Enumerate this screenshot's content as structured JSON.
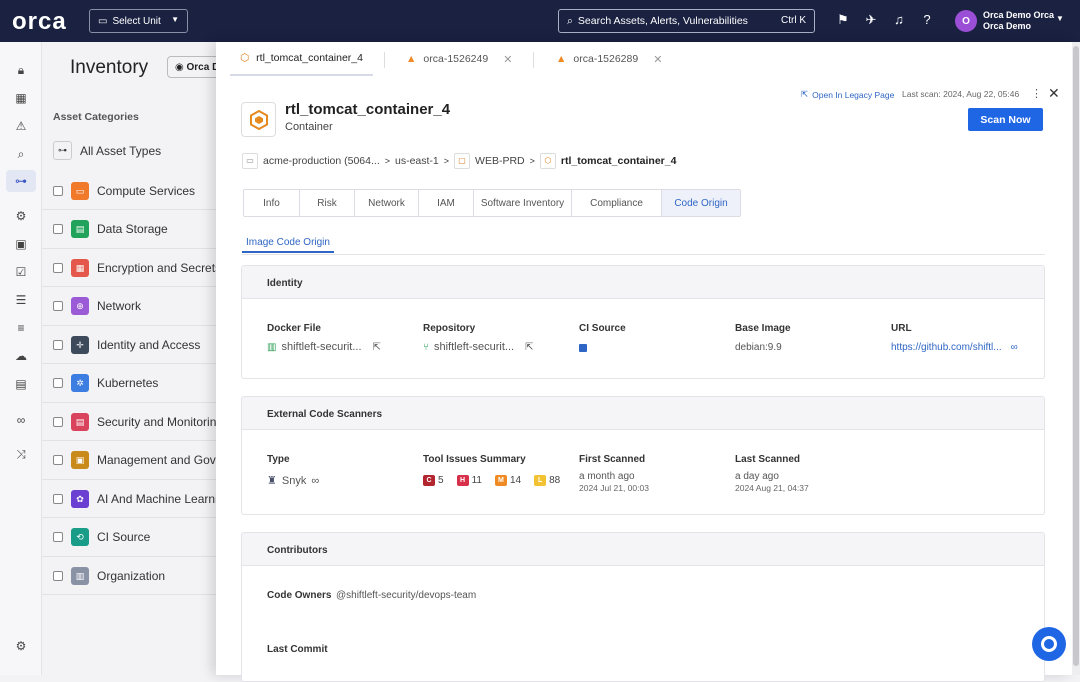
{
  "app": {
    "logo": "orca",
    "unit_select": "Select Unit",
    "search_placeholder": "Search Assets, Alerts, Vulnerabilities",
    "search_shortcut": "Ctrl K",
    "user": {
      "initial": "O",
      "name": "Orca Demo Orca",
      "org": "Orca Demo"
    }
  },
  "inventory": {
    "title": "Inventory",
    "pill": "Orca D",
    "categories_label": "Asset Categories",
    "all_types": "All Asset Types",
    "categories": [
      {
        "label": "Compute Services",
        "color": "#f07a2a"
      },
      {
        "label": "Data Storage",
        "color": "#22a35b"
      },
      {
        "label": "Encryption and Secrets",
        "color": "#e4574b"
      },
      {
        "label": "Network",
        "color": "#9c5bd6"
      },
      {
        "label": "Identity and Access",
        "color": "#3d4a5c"
      },
      {
        "label": "Kubernetes",
        "color": "#3b7de0"
      },
      {
        "label": "Security and Monitoring",
        "color": "#d9435b"
      },
      {
        "label": "Management and Governance",
        "color": "#c98a1a"
      },
      {
        "label": "AI And Machine Learning",
        "color": "#6a3fd1"
      },
      {
        "label": "CI Source",
        "color": "#199c88"
      },
      {
        "label": "Organization",
        "color": "#8a93a6"
      }
    ]
  },
  "drawer": {
    "tabs": [
      {
        "label": "rtl_tomcat_container_4",
        "kind": "asset"
      },
      {
        "label": "orca-1526249",
        "kind": "alert"
      },
      {
        "label": "orca-1526289",
        "kind": "alert"
      }
    ],
    "asset_name": "rtl_tomcat_container_4",
    "asset_type": "Container",
    "legacy_link": "Open In Legacy Page",
    "last_scan": "Last scan: 2024, Aug 22, 05:46",
    "scan_button": "Scan Now",
    "breadcrumb": [
      "acme-production (5064...",
      "us-east-1",
      "WEB-PRD",
      "rtl_tomcat_container_4"
    ],
    "main_tabs": [
      "Info",
      "Risk",
      "Network",
      "IAM",
      "Software Inventory",
      "Compliance",
      "Code Origin"
    ],
    "active_tab": "Code Origin",
    "sub_tab": "Image Code Origin",
    "identity": {
      "title": "Identity",
      "docker_file_label": "Docker File",
      "docker_file": "shiftleft-securit...",
      "repository_label": "Repository",
      "repository": "shiftleft-securit...",
      "ci_source_label": "CI Source",
      "base_image_label": "Base Image",
      "base_image": "debian:9.9",
      "url_label": "URL",
      "url": "https://github.com/shiftl..."
    },
    "scanners": {
      "title": "External Code Scanners",
      "type_label": "Type",
      "type": "Snyk",
      "summary_label": "Tool Issues Summary",
      "severities": [
        {
          "code": "C",
          "count": "5",
          "color": "#b3262f"
        },
        {
          "code": "H",
          "count": "11",
          "color": "#d8304a"
        },
        {
          "code": "M",
          "count": "14",
          "color": "#f08a24"
        },
        {
          "code": "L",
          "count": "88",
          "color": "#f2c233"
        }
      ],
      "first_label": "First Scanned",
      "first_rel": "a month ago",
      "first_abs": "2024 Jul 21, 00:03",
      "last_label": "Last Scanned",
      "last_rel": "a day ago",
      "last_abs": "2024 Aug 21, 04:37"
    },
    "contributors": {
      "title": "Contributors",
      "owners_label": "Code Owners",
      "owners": "@shiftleft-security/devops-team",
      "last_commit_label": "Last Commit"
    }
  }
}
